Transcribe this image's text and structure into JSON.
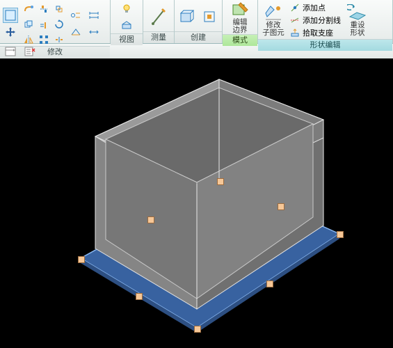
{
  "ribbon": {
    "panels": {
      "modify": "修改",
      "view": "视图",
      "measure": "测量",
      "create": "创建",
      "mode": "模式",
      "shape_edit": "形状编辑"
    },
    "buttons": {
      "edit_boundary_l1": "编辑",
      "edit_boundary_l2": "边界",
      "modify_sub_l1": "修改",
      "modify_sub_l2": "子图元",
      "reset_l1": "重设",
      "reset_l2": "形状",
      "add_point": "添加点",
      "add_split_line": "添加分割线",
      "pick_support": "拾取支座"
    }
  },
  "colors": {
    "slab": "#3862a0",
    "slab_edge": "#88b6f0",
    "box_fill": "#8a8a8a",
    "box_edge": "#e4e4e4",
    "box_top": "#a8a8a8"
  }
}
